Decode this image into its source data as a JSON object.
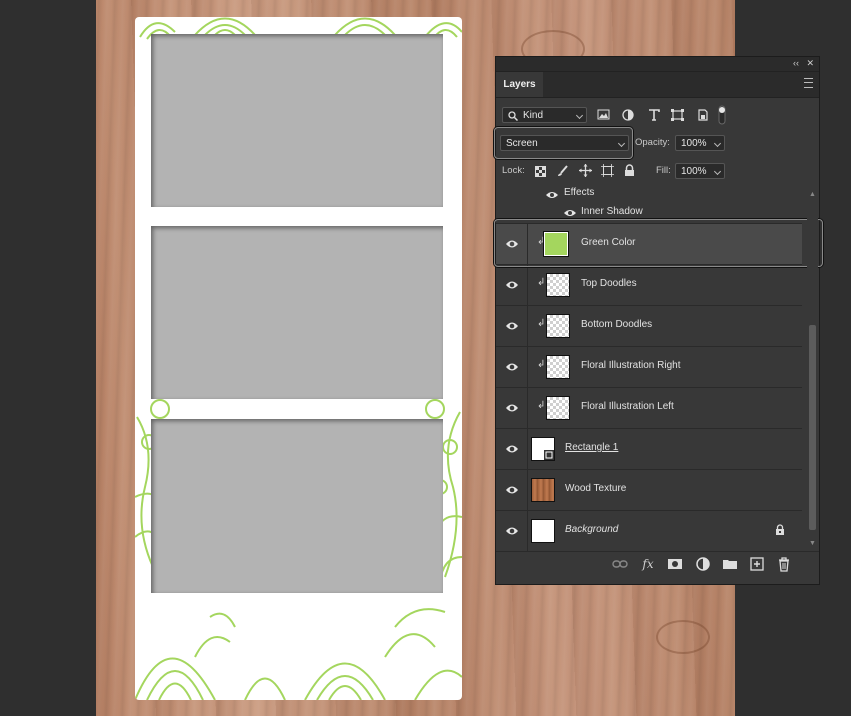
{
  "panel": {
    "tab_label": "Layers",
    "collapse_glyph": "‹‹",
    "close_glyph": "✕",
    "filter": {
      "kind_label": "Kind",
      "icons": [
        "image-filter-icon",
        "adjustment-filter-icon",
        "type-filter-icon",
        "shape-filter-icon",
        "smart-object-filter-icon",
        "filter-toggle-icon"
      ]
    },
    "blend_mode": "Screen",
    "opacity_label": "Opacity:",
    "opacity_value": "100%",
    "lock_label": "Lock:",
    "fill_label": "Fill:",
    "fill_value": "100%",
    "effects_label": "Effects",
    "inner_shadow_label": "Inner Shadow",
    "layers": [
      {
        "name": "Green Color",
        "clipped": true,
        "selected": true,
        "thumb": "green",
        "color": "#a4d65e"
      },
      {
        "name": "Top Doodles",
        "clipped": true,
        "selected": false,
        "thumb": "transparent"
      },
      {
        "name": "Bottom Doodles",
        "clipped": true,
        "selected": false,
        "thumb": "transparent"
      },
      {
        "name": "Floral Illustration Right",
        "clipped": true,
        "selected": false,
        "thumb": "transparent"
      },
      {
        "name": "Floral Illustration Left",
        "clipped": true,
        "selected": false,
        "thumb": "transparent"
      },
      {
        "name": "Rectangle 1",
        "clipped": false,
        "selected": false,
        "thumb": "shape"
      },
      {
        "name": "Wood Texture",
        "clipped": false,
        "selected": false,
        "thumb": "wood"
      },
      {
        "name": "Background",
        "clipped": false,
        "selected": false,
        "thumb": "white",
        "locked": true
      }
    ],
    "bottom_icons": [
      "link-layers-icon",
      "fx-icon",
      "add-mask-icon",
      "adjustment-layer-icon",
      "new-group-icon",
      "new-layer-icon",
      "delete-layer-icon"
    ],
    "fx_text": "fx"
  },
  "canvas": {
    "doodle_color": "#a4d65e",
    "photo_color": "#b3b3b3"
  }
}
